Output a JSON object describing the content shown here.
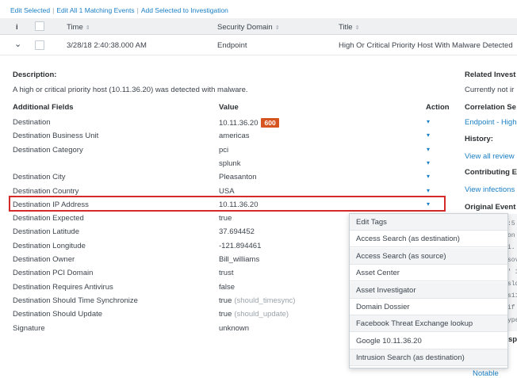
{
  "toolbar": {
    "edit_selected": "Edit Selected",
    "edit_all": "Edit All 1 Matching Events",
    "add_selected": "Add Selected to Investigation"
  },
  "table": {
    "info_header": "i",
    "time_header": "Time",
    "domain_header": "Security Domain",
    "title_header": "Title",
    "sort_glyph": "⇕",
    "row": {
      "expand_glyph": "⌄",
      "time": "3/28/18 2:40:38.000 AM",
      "domain": "Endpoint",
      "title": "High Or Critical Priority Host With Malware Detected"
    }
  },
  "details": {
    "description_label": "Description:",
    "description_text": "A high or critical priority host (10.11.36.20) was detected with malware.",
    "fields_header": "Additional Fields",
    "value_header": "Value",
    "action_header": "Action",
    "caret_glyph": "▾",
    "fields": [
      {
        "label": "Destination",
        "value": "10.11.36.20",
        "badge": "600",
        "caret": true
      },
      {
        "label": "Destination Business Unit",
        "value": "americas",
        "caret": true
      },
      {
        "label": "Destination Category",
        "value": "pci",
        "caret": true
      },
      {
        "label": "",
        "value": "splunk",
        "caret": true
      },
      {
        "label": "Destination City",
        "value": "Pleasanton",
        "caret": true
      },
      {
        "label": "Destination Country",
        "value": "USA",
        "caret": true
      },
      {
        "label": "Destination IP Address",
        "value": "10.11.36.20",
        "caret": true
      },
      {
        "label": "Destination Expected",
        "value": "true"
      },
      {
        "label": "Destination Latitude",
        "value": "37.694452"
      },
      {
        "label": "Destination Longitude",
        "value": "-121.894461"
      },
      {
        "label": "Destination Owner",
        "value": "Bill_williams"
      },
      {
        "label": "Destination PCI Domain",
        "value": "trust"
      },
      {
        "label": "Destination Requires Antivirus",
        "value": "false"
      },
      {
        "label": "Destination Should Time Synchronize",
        "value": "true",
        "extra": "(should_timesync)"
      },
      {
        "label": "Destination Should Update",
        "value": "true",
        "extra": "(should_update)"
      },
      {
        "label": "Signature",
        "value": "unknown"
      }
    ]
  },
  "right_panel": {
    "related_title": "Related Invest",
    "related_text": "Currently not ir",
    "correlation_title": "Correlation Se",
    "correlation_link": "Endpoint - High",
    "history_title": "History:",
    "history_link": "View all review",
    "contributing_title": "Contributing E",
    "contributing_link": "View infections",
    "original_title": "Original Event",
    "code_lines": [
      ":5",
      "on",
      "i.",
      "sov",
      "' 1",
      "sld",
      "s11",
      "if",
      "ype"
    ],
    "sp_fragment": "sp",
    "notable_link": "Notable"
  },
  "context_menu": {
    "items": [
      "Edit Tags",
      "Access Search (as destination)",
      "Access Search (as source)",
      "Asset Center",
      "Asset Investigator",
      "Domain Dossier",
      "Facebook Threat Exchange lookup",
      "Google 10.11.36.20",
      "Intrusion Search (as destination)"
    ]
  }
}
